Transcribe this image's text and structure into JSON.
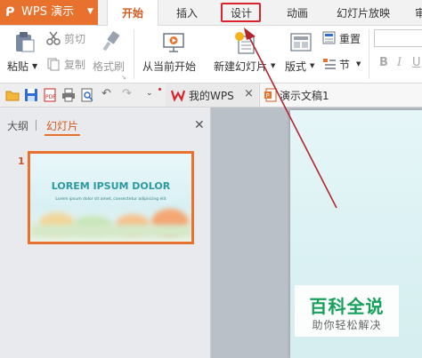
{
  "app": {
    "title": "WPS 演示"
  },
  "tabs": {
    "start": "开始",
    "insert": "插入",
    "design": "设计",
    "animation": "动画",
    "slideshow": "幻灯片放映",
    "review": "审"
  },
  "ribbon": {
    "paste": "粘贴",
    "cut": "剪切",
    "copy": "复制",
    "format_painter": "格式刷",
    "from_current": "从当前开始",
    "new_slide": "新建幻灯片",
    "layout": "版式",
    "reset": "重置",
    "section": "节",
    "bold": "B",
    "italic": "I",
    "underline": "U"
  },
  "quick_access": {
    "doc_tabs": [
      {
        "label": "我的WPS"
      },
      {
        "label": "演示文稿1"
      }
    ]
  },
  "left_panel": {
    "tab_outline": "大纲",
    "tab_slides": "幻灯片",
    "slide_number": "1",
    "thumbnail_title": "LOREM IPSUM DOLOR",
    "thumbnail_subtitle": "Lorem ipsum dolor sit amet, consectetur adipiscing elit"
  },
  "watermark": {
    "title": "百科全说",
    "subtitle": "助你轻松解决"
  },
  "colors": {
    "accent": "#e8722d",
    "highlight": "#d9232d",
    "watermark_green": "#16a05a"
  }
}
